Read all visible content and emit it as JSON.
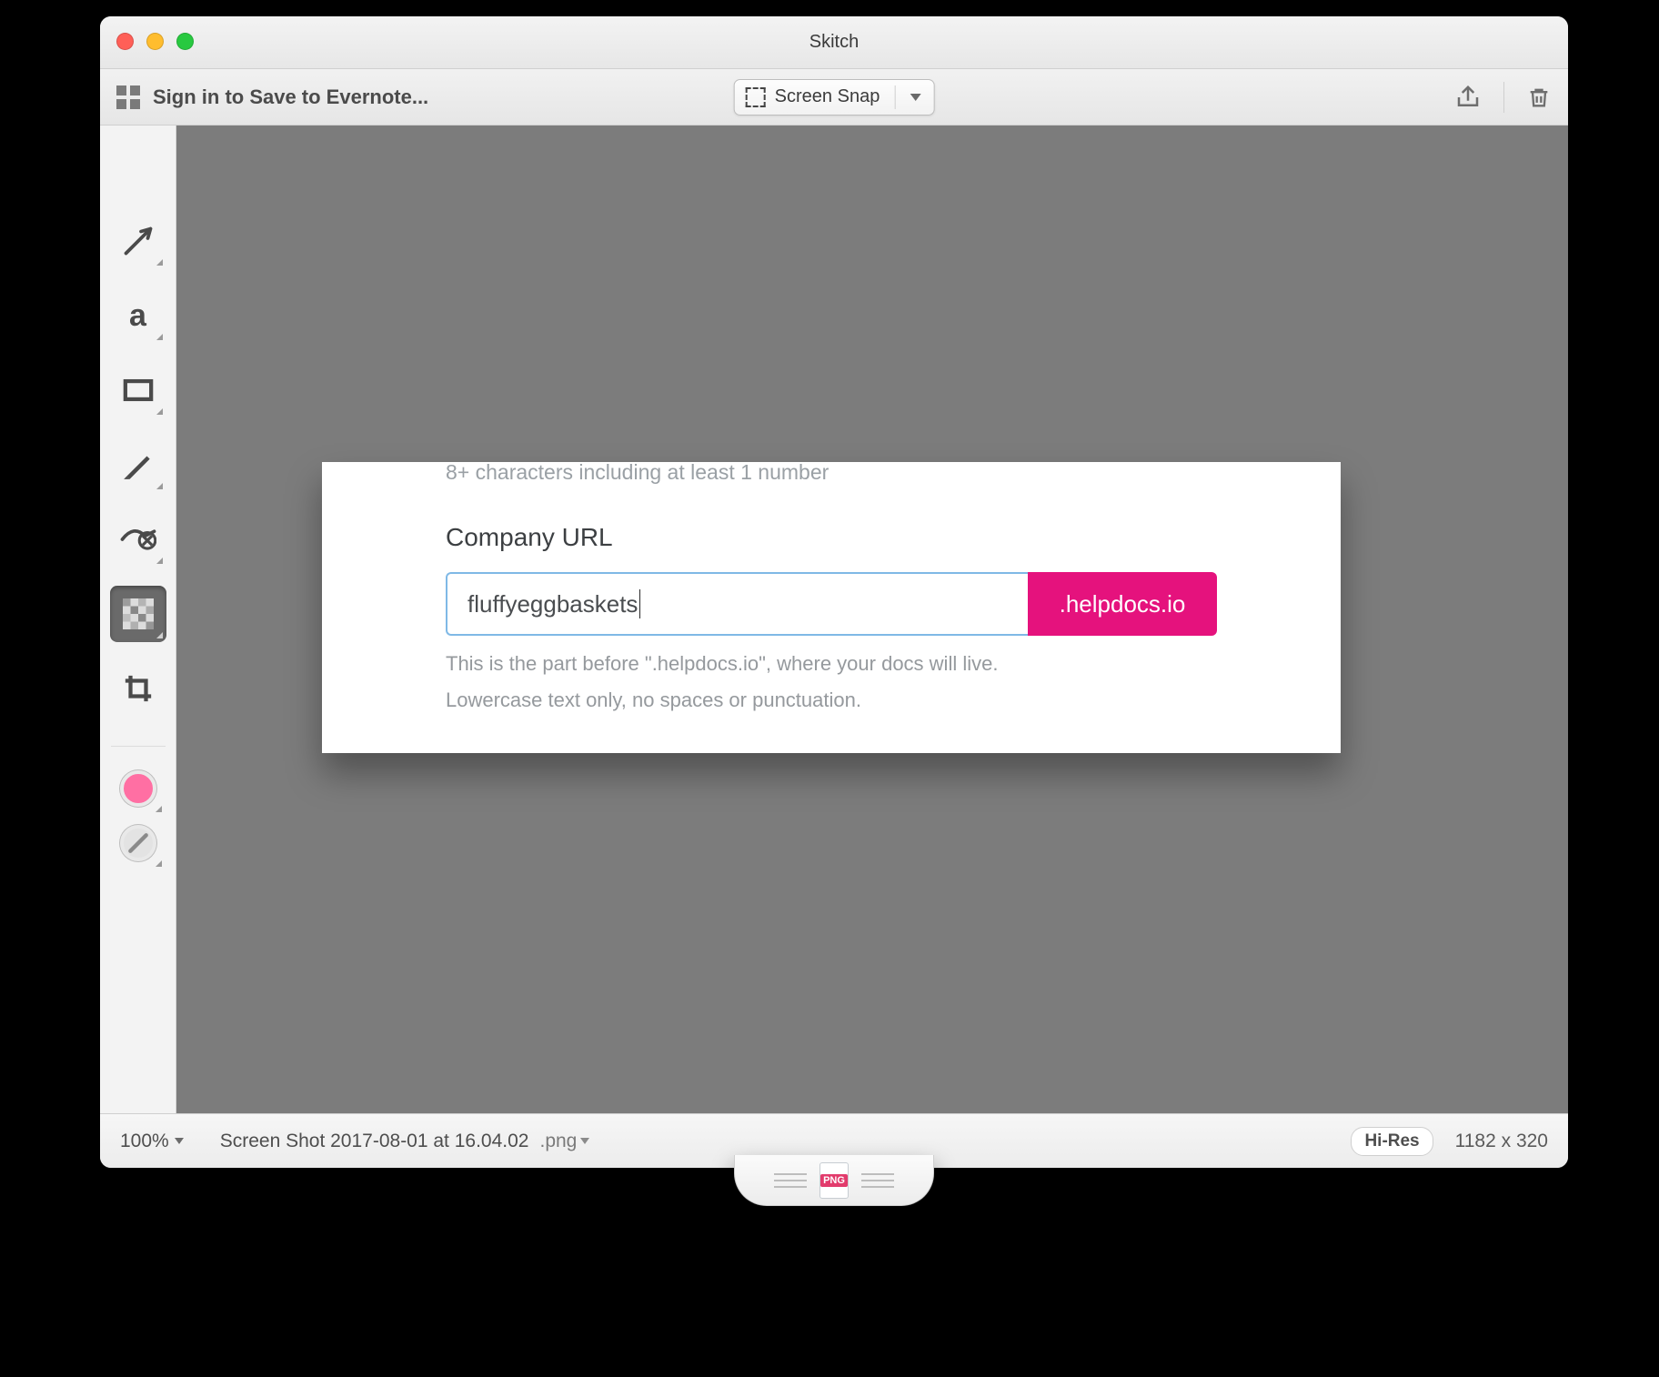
{
  "window": {
    "title": "Skitch"
  },
  "toolbar": {
    "signin_label": "Sign in to Save to Evernote...",
    "capture_label": "Screen Snap"
  },
  "sidebar": {
    "tools": [
      "arrow",
      "text",
      "rect",
      "marker",
      "stamp",
      "pixelate",
      "crop"
    ],
    "selected": "pixelate",
    "color": "#ff6fa3"
  },
  "card": {
    "hint_top": "8+ characters including at least 1 number",
    "label": "Company URL",
    "input_value": "fluffyeggbaskets",
    "suffix": ".helpdocs.io",
    "help1": "This is the part before \".helpdocs.io\", where your docs will live.",
    "help2": "Lowercase text only, no spaces or punctuation."
  },
  "status": {
    "zoom": "100%",
    "filename": "Screen Shot 2017-08-01 at 16.04.02",
    "ext": ".png",
    "hires": "Hi-Res",
    "dimensions": "1182 x 320",
    "drag_format": "PNG"
  }
}
